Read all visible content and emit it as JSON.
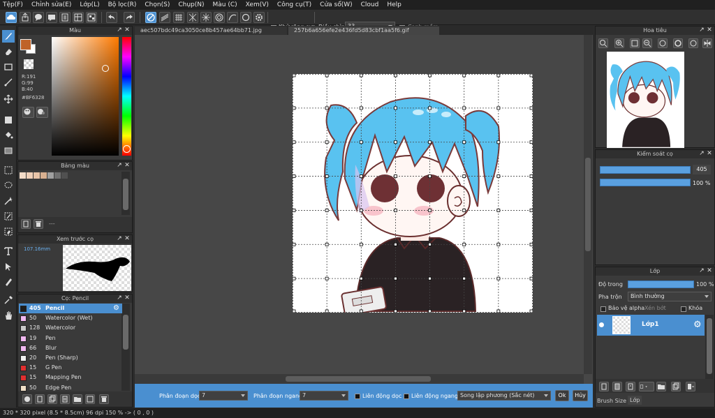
{
  "menu": [
    "Tệp(F)",
    "Chỉnh sửa(E)",
    "Lớp(L)",
    "Bộ lọc(R)",
    "Chọn(S)",
    "Chụp(N)",
    "Màu (C)",
    "Xem(V)",
    "Công cụ(T)",
    "Cửa sổ(W)",
    "Cloud",
    "Help"
  ],
  "toolbar": {
    "antialias_label": "Khử răng cưa",
    "antialias_checked": true,
    "adjust_label": "Điều chỉnh",
    "adjust_value": "33",
    "edge_label": "Cạnh mềm",
    "edge_checked": false
  },
  "color_panel": {
    "title": "Màu",
    "rgb_r": "R:191",
    "rgb_g": "G:99",
    "rgb_b": "B:40",
    "hex": "#BF6328",
    "main_color": "#BF6328"
  },
  "palette_panel": {
    "title": "Bảng màu",
    "swatches": [
      "#f4dcc8",
      "#f0d0b8",
      "#e8c4a8",
      "#d8b090",
      "#a0a0a0",
      "#707070",
      "#505050"
    ],
    "separator": "---"
  },
  "brush_preview": {
    "title": "Xem trước cọ",
    "size_text": "107.16mm"
  },
  "brush_panel": {
    "title": "Cọ: Pencil",
    "items": [
      {
        "size": "405",
        "name": "Pencil",
        "color": "#1c1c1c",
        "selected": true
      },
      {
        "size": "50",
        "name": "Watercolor (Wet)",
        "color": "#f0b8f0"
      },
      {
        "size": "128",
        "name": "Watercolor",
        "color": "#c8c8c8"
      },
      {
        "size": "19",
        "name": "Pen",
        "color": "#f0b8f0"
      },
      {
        "size": "66",
        "name": "Blur",
        "color": "#f0b8f0"
      },
      {
        "size": "20",
        "name": "Pen (Sharp)",
        "color": "#f0f0f0"
      },
      {
        "size": "15",
        "name": "G Pen",
        "color": "#e03030"
      },
      {
        "size": "15",
        "name": "Mapping Pen",
        "color": "#e03030"
      },
      {
        "size": "50",
        "name": "Edge Pen",
        "color": "#f0e0c8"
      }
    ]
  },
  "tabs": [
    "aec507bdc49ca3050ce8b457ae64bb71.jpg",
    "257b6a656efe2e436fd5d83cbf1aa5f6.gif"
  ],
  "options_bar": {
    "vertical_label": "Phân đoạn dọc",
    "vertical_value": "7",
    "horizontal_label": "Phân đoạn ngang",
    "horizontal_value": "7",
    "link_v_label": "Liên động dọc",
    "link_h_label": "Liên động ngang",
    "mode_value": "Song lập phương (Sắc nét)",
    "ok_label": "Ok",
    "cancel_label": "Hủy"
  },
  "navigator": {
    "title": "Hoa tiêu"
  },
  "brush_control": {
    "title": "Kiểm soát cọ",
    "size_value": "405",
    "opacity_value": "100 %",
    "size_fraction": 1.0,
    "opacity_fraction": 1.0
  },
  "layers_panel": {
    "title": "Lớp",
    "opacity_label": "Độ trong",
    "opacity_value": "100 %",
    "opacity_fraction": 1.0,
    "blend_label": "Pha trộn",
    "blend_value": "Bình thường",
    "protect_alpha": "Bảo vệ alpha",
    "clipping": "Xén bớt",
    "lock": "Khóa",
    "layer_name": "Lớp1"
  },
  "bottom_tabs": [
    "Brush Size",
    "Lớp"
  ],
  "status": "320 * 320 pixel   (8.5 * 8.5cm)   96 dpi   150 %   -> ( 0 , 0 )",
  "grid": {
    "rows": 7,
    "cols": 7
  }
}
